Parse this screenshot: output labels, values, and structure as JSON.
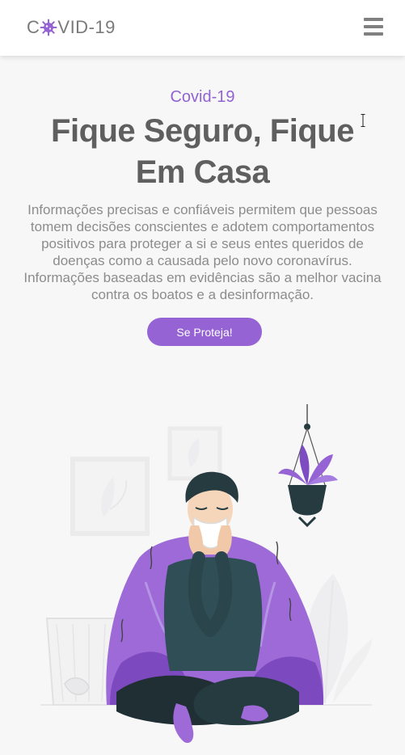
{
  "navbar": {
    "logo_prefix": "C",
    "logo_suffix": "VID-19",
    "logo_icon": "virus-icon",
    "menu_icon": "hamburger-icon"
  },
  "hero": {
    "eyebrow": "Covid-19",
    "headline": "Fique Seguro, Fique Em Casa",
    "description": "Informações precisas e confiáveis permitem que pessoas tomem decisões conscientes e adotem comportamentos positivos para proteger a si e seus entes queridos de doenças como a causada pelo novo coronavírus. Informações baseadas em evidências são a melhor vacina contra os boatos e a desinformação.",
    "cta_label": "Se Proteja!"
  },
  "illustration": {
    "subject": "sick-person-illustration"
  },
  "colors": {
    "accent": "#9563d3",
    "headline": "#5f5f5f",
    "body_text": "#8c8c8c",
    "background": "#f7f7f8"
  }
}
